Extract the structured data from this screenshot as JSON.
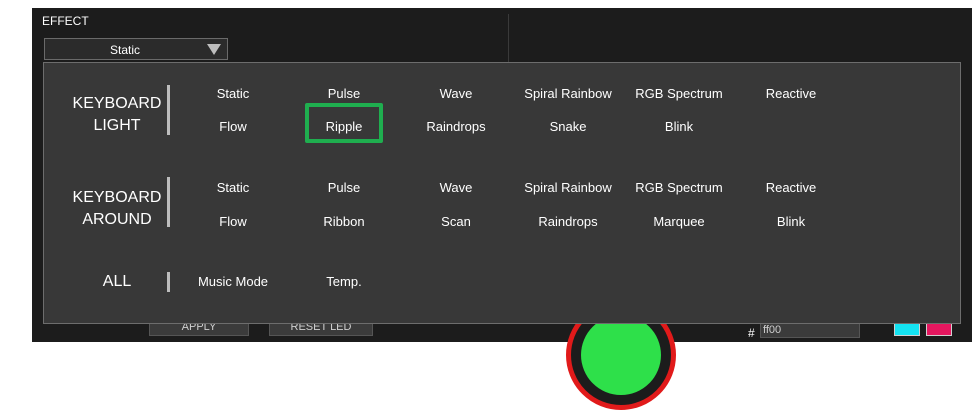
{
  "effect": {
    "label": "EFFECT",
    "selected": "Static"
  },
  "background": {
    "apply_label": "APPLY",
    "reset_label": "RESET LED",
    "hex_prefix": "#",
    "hex_value": "ff00",
    "swatch_colors": [
      "#14e3f2",
      "#e5175f"
    ]
  },
  "dropdown": {
    "groups": [
      {
        "label_lines": [
          "KEYBOARD",
          "LIGHT"
        ],
        "rows": [
          [
            "Static",
            "Pulse",
            "Wave",
            "Spiral Rainbow",
            "RGB Spectrum",
            "Reactive"
          ],
          [
            "Flow",
            "Ripple",
            "Raindrops",
            "Snake",
            "Blink"
          ]
        ]
      },
      {
        "label_lines": [
          "KEYBOARD",
          "AROUND"
        ],
        "rows": [
          [
            "Static",
            "Pulse",
            "Wave",
            "Spiral Rainbow",
            "RGB Spectrum",
            "Reactive"
          ],
          [
            "Flow",
            "Ribbon",
            "Scan",
            "Raindrops",
            "Marquee",
            "Blink"
          ]
        ]
      },
      {
        "label_lines": [
          "ALL"
        ],
        "rows": [
          [
            "Music Mode",
            "Temp."
          ]
        ]
      }
    ],
    "highlighted": "Ripple"
  }
}
